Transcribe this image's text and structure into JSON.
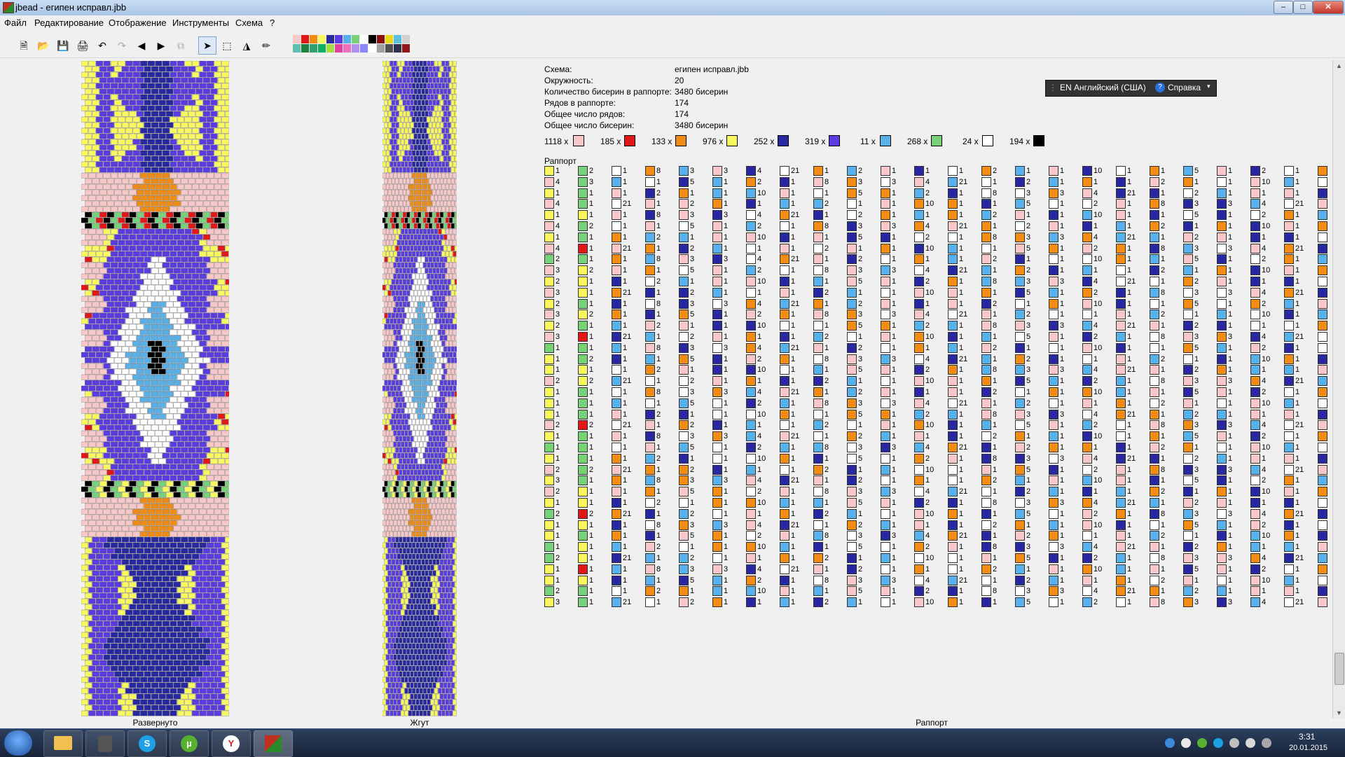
{
  "window": {
    "title": "jbead - египен исправл.jbb"
  },
  "menu": [
    "Файл",
    "Редактирование",
    "Отображение",
    "Инструменты",
    "Схема",
    "?"
  ],
  "toolbar": {
    "tools": [
      "new-file-icon",
      "open-icon",
      "save-icon",
      "print-icon",
      "undo-icon",
      "redo-icon",
      "arrow-left-icon",
      "arrow-right-icon",
      "copy-icon",
      "pointer-icon",
      "selection-icon",
      "fill-icon",
      "pipette-icon"
    ],
    "palette_colors": [
      "#f8c8c8",
      "#e01818",
      "#f08c14",
      "#f8f860",
      "#2828a0",
      "#5a3ce0",
      "#58b0e8",
      "#78d078",
      "#ffffff",
      "#000000",
      "#8a1010",
      "#e8d818",
      "#5ac0e0",
      "#d0d0d0",
      "#60c0b0",
      "#208040",
      "#30a070",
      "#10b060",
      "#a0e040",
      "#e040a0",
      "#f070c0",
      "#b090f0",
      "#8888ff",
      "#ffffff",
      "#a0a0a0",
      "#505050",
      "#303050",
      "#901818"
    ]
  },
  "labels": {
    "expanded": "Развернуто",
    "rope": "Жгут",
    "report": "Раппорт",
    "report_title": "Раппорт"
  },
  "info": [
    {
      "label": "Схема:",
      "value": "египен исправл.jbb"
    },
    {
      "label": "Окружность:",
      "value": "20"
    },
    {
      "label": "Количество бисерин в раппорте:",
      "value": "3480 бисерин"
    },
    {
      "label": "Рядов в раппорте:",
      "value": "174"
    },
    {
      "label": "Общее число рядов:",
      "value": "174"
    },
    {
      "label": "Общее число бисерин:",
      "value": "3480 бисерин"
    }
  ],
  "bead_counts": [
    {
      "count": "1118 x",
      "color": "#f8c8c8"
    },
    {
      "count": "185 x",
      "color": "#e01818"
    },
    {
      "count": "133 x",
      "color": "#f08c14"
    },
    {
      "count": "976 x",
      "color": "#f8f860"
    },
    {
      "count": "252 x",
      "color": "#2828a0"
    },
    {
      "count": "319 x",
      "color": "#5a3ce0"
    },
    {
      "count": "11 x",
      "color": "#58b0e8"
    },
    {
      "count": "268 x",
      "color": "#78d078"
    },
    {
      "count": "24 x",
      "color": "#ffffff"
    },
    {
      "count": "194 x",
      "color": "#000000"
    }
  ],
  "language_bar": {
    "language": "EN Английский (США)",
    "help": "Справка"
  },
  "colors": {
    "pink": "#f8c8c8",
    "red": "#e01818",
    "orange": "#f08c14",
    "yellow": "#f8f860",
    "navy": "#2828a0",
    "violet": "#5a3ce0",
    "lightblue": "#58b0e8",
    "green": "#78d078",
    "white": "#ffffff",
    "black": "#000000"
  },
  "report_col0": [
    {
      "c": "yellow",
      "n": "1"
    },
    {
      "c": "pink",
      "n": "4"
    },
    {
      "c": "yellow",
      "n": "1"
    },
    {
      "c": "pink",
      "n": "4"
    },
    {
      "c": "yellow",
      "n": "1"
    },
    {
      "c": "pink",
      "n": "4"
    },
    {
      "c": "yellow",
      "n": "1"
    },
    {
      "c": "pink",
      "n": "4"
    },
    {
      "c": "green",
      "n": "2"
    },
    {
      "c": "pink",
      "n": "3"
    },
    {
      "c": "yellow",
      "n": "2"
    },
    {
      "c": "pink",
      "n": "3"
    },
    {
      "c": "yellow",
      "n": "2"
    },
    {
      "c": "pink",
      "n": "3"
    },
    {
      "c": "yellow",
      "n": "2"
    },
    {
      "c": "pink",
      "n": "3"
    },
    {
      "c": "green",
      "n": "1"
    },
    {
      "c": "yellow",
      "n": "1"
    },
    {
      "c": "yellow",
      "n": "1"
    },
    {
      "c": "pink",
      "n": "2"
    },
    {
      "c": "yellow",
      "n": "1"
    },
    {
      "c": "yellow",
      "n": "1"
    },
    {
      "c": "yellow",
      "n": "1"
    },
    {
      "c": "pink",
      "n": "2"
    },
    {
      "c": "yellow",
      "n": "1"
    },
    {
      "c": "green",
      "n": "1"
    },
    {
      "c": "yellow",
      "n": "1"
    },
    {
      "c": "pink",
      "n": "2"
    },
    {
      "c": "yellow",
      "n": "3"
    },
    {
      "c": "pink",
      "n": "2"
    },
    {
      "c": "yellow",
      "n": "1"
    },
    {
      "c": "green",
      "n": "2"
    },
    {
      "c": "yellow",
      "n": "1"
    },
    {
      "c": "yellow",
      "n": "1"
    },
    {
      "c": "green",
      "n": "1"
    },
    {
      "c": "green",
      "n": "2"
    },
    {
      "c": "yellow",
      "n": "1"
    },
    {
      "c": "yellow",
      "n": "1"
    },
    {
      "c": "green",
      "n": "2"
    },
    {
      "c": "yellow",
      "n": "3"
    }
  ],
  "report_col1": [
    {
      "c": "green",
      "n": "2"
    },
    {
      "c": "green",
      "n": "3"
    },
    {
      "c": "green",
      "n": "1"
    },
    {
      "c": "green",
      "n": "1"
    },
    {
      "c": "yellow",
      "n": "1"
    },
    {
      "c": "green",
      "n": "2"
    },
    {
      "c": "green",
      "n": "1"
    },
    {
      "c": "red",
      "n": "1"
    },
    {
      "c": "green",
      "n": "1"
    },
    {
      "c": "yellow",
      "n": "2"
    },
    {
      "c": "yellow",
      "n": "1"
    },
    {
      "c": "yellow",
      "n": "1"
    },
    {
      "c": "green",
      "n": "1"
    },
    {
      "c": "yellow",
      "n": "2"
    },
    {
      "c": "green",
      "n": "1"
    },
    {
      "c": "red",
      "n": "1"
    },
    {
      "c": "green",
      "n": "1"
    },
    {
      "c": "green",
      "n": "2"
    },
    {
      "c": "yellow",
      "n": "1"
    },
    {
      "c": "yellow",
      "n": "2"
    },
    {
      "c": "green",
      "n": "1"
    },
    {
      "c": "green",
      "n": "1"
    },
    {
      "c": "green",
      "n": "1"
    },
    {
      "c": "red",
      "n": "2"
    },
    {
      "c": "green",
      "n": "1"
    },
    {
      "c": "green",
      "n": "1"
    },
    {
      "c": "green",
      "n": "1"
    },
    {
      "c": "green",
      "n": "2"
    },
    {
      "c": "green",
      "n": "1"
    },
    {
      "c": "yellow",
      "n": "1"
    },
    {
      "c": "yellow",
      "n": "1"
    },
    {
      "c": "red",
      "n": "2"
    },
    {
      "c": "yellow",
      "n": "1"
    },
    {
      "c": "green",
      "n": "1"
    },
    {
      "c": "yellow",
      "n": "1"
    },
    {
      "c": "yellow",
      "n": "1"
    },
    {
      "c": "red",
      "n": "1"
    },
    {
      "c": "yellow",
      "n": "1"
    },
    {
      "c": "green",
      "n": "1"
    },
    {
      "c": "green",
      "n": "1"
    }
  ]
}
